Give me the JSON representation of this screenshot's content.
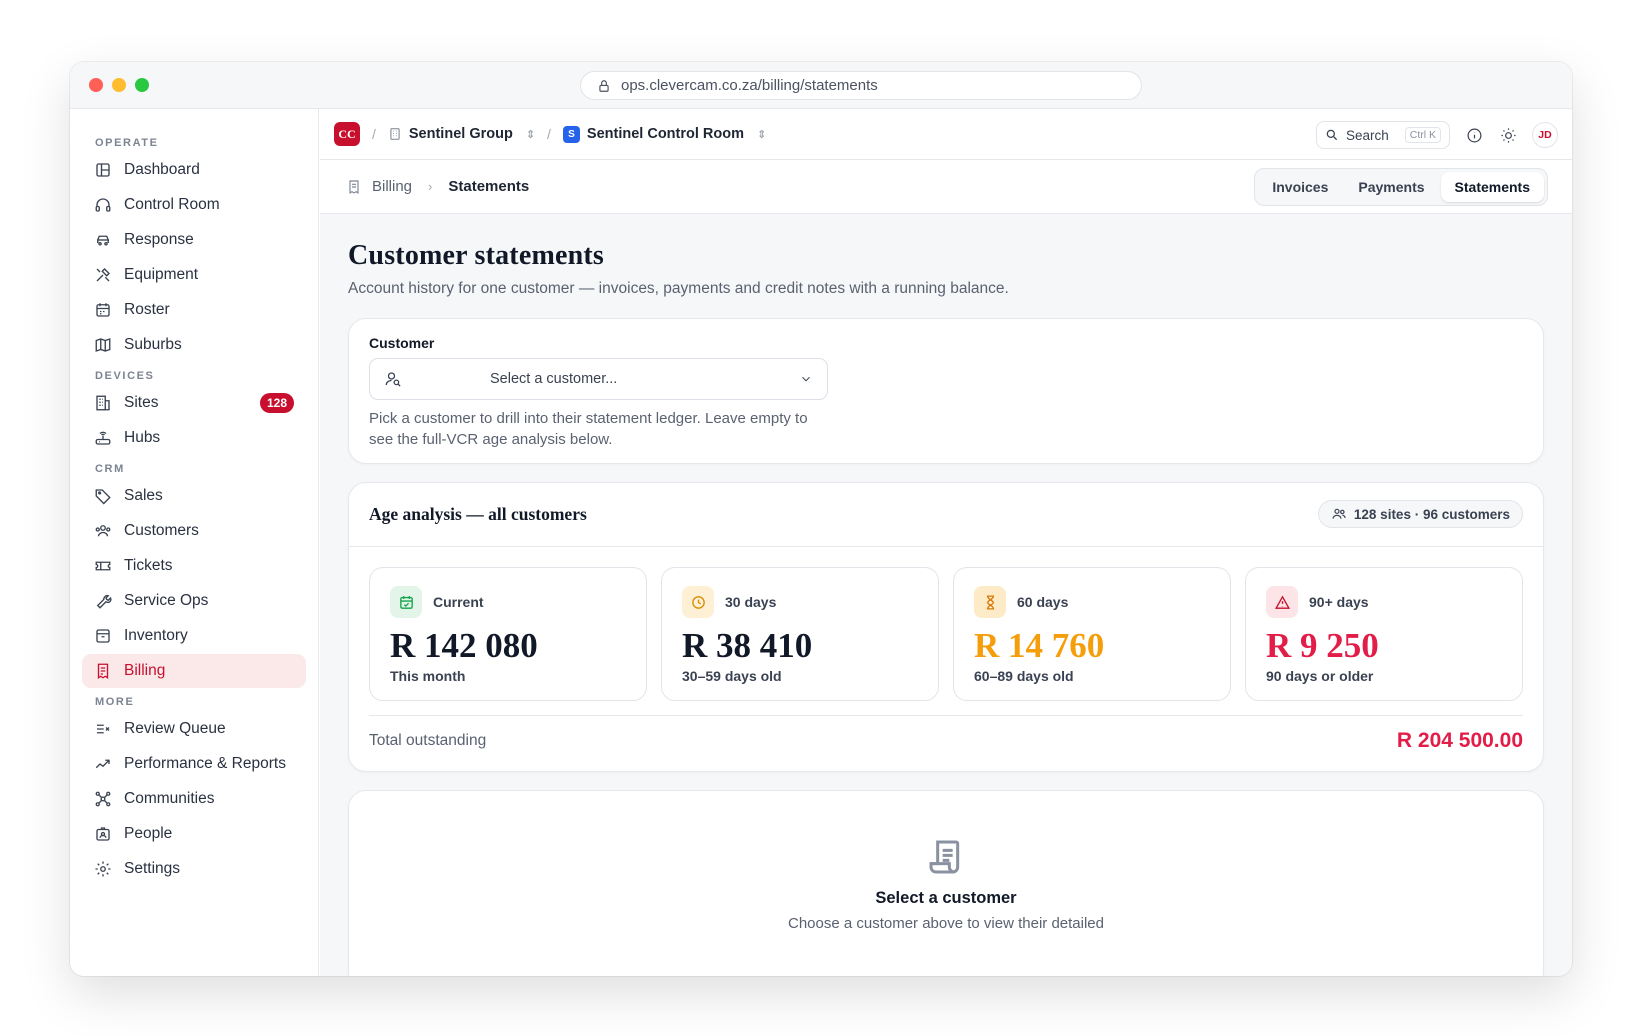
{
  "browser": {
    "url": "ops.clevercam.co.za/billing/statements"
  },
  "sidebar": {
    "sections": [
      {
        "title": "OPERATE",
        "items": [
          {
            "label": "Dashboard",
            "icon": "layout-icon"
          },
          {
            "label": "Control Room",
            "icon": "headset-icon"
          },
          {
            "label": "Response",
            "icon": "car-icon"
          },
          {
            "label": "Equipment",
            "icon": "tools-icon"
          },
          {
            "label": "Roster",
            "icon": "calendar-icon"
          },
          {
            "label": "Suburbs",
            "icon": "map-icon"
          }
        ]
      },
      {
        "title": "DEVICES",
        "items": [
          {
            "label": "Sites",
            "icon": "building-icon",
            "badge": "128"
          },
          {
            "label": "Hubs",
            "icon": "router-icon"
          }
        ]
      },
      {
        "title": "CRM",
        "items": [
          {
            "label": "Sales",
            "icon": "tag-icon"
          },
          {
            "label": "Customers",
            "icon": "users-icon"
          },
          {
            "label": "Tickets",
            "icon": "ticket-icon"
          },
          {
            "label": "Service Ops",
            "icon": "wrench-icon"
          },
          {
            "label": "Inventory",
            "icon": "archive-icon"
          },
          {
            "label": "Billing",
            "icon": "receipt-icon",
            "active": true
          }
        ]
      },
      {
        "title": "MORE",
        "items": [
          {
            "label": "Review Queue",
            "icon": "list-check-icon"
          },
          {
            "label": "Performance & Reports",
            "icon": "trend-icon"
          },
          {
            "label": "Communities",
            "icon": "network-icon"
          },
          {
            "label": "People",
            "icon": "id-badge-icon"
          },
          {
            "label": "Settings",
            "icon": "gear-icon"
          }
        ]
      }
    ]
  },
  "topbar": {
    "logo": "CC",
    "org": "Sentinel Group",
    "room_badge": "S",
    "room": "Sentinel Control Room",
    "search_label": "Search",
    "search_shortcut": "Ctrl K",
    "avatar": "JD"
  },
  "subbar": {
    "breadcrumb_parent": "Billing",
    "breadcrumb_current": "Statements",
    "tabs": [
      "Invoices",
      "Payments",
      "Statements"
    ],
    "active_tab": "Statements"
  },
  "page": {
    "title": "Customer statements",
    "lead": "Account history for one customer — invoices, payments and credit notes with a running balance."
  },
  "customer_card": {
    "label": "Customer",
    "placeholder": "Select a customer...",
    "hint": "Pick a customer to drill into their statement ledger. Leave empty to see the full-VCR age analysis below."
  },
  "age_analysis": {
    "title": "Age analysis — all customers",
    "summary": "128 sites · 96 customers",
    "buckets": [
      {
        "label": "Current",
        "amount": "R 142 080",
        "sub": "This month",
        "color": "#111827",
        "icon_bg": "#e3f5e8",
        "icon_color": "#16a34a"
      },
      {
        "label": "30 days",
        "amount": "R 38 410",
        "sub": "30–59 days old",
        "color": "#111827",
        "icon_bg": "#fdf0d5",
        "icon_color": "#d98e04"
      },
      {
        "label": "60 days",
        "amount": "R 14 760",
        "sub": "60–89 days old",
        "color": "#f59e0b",
        "icon_bg": "#fdebc8",
        "icon_color": "#d97706"
      },
      {
        "label": "90+ days",
        "amount": "R 9 250",
        "sub": "90 days or older",
        "color": "#e11d48",
        "icon_bg": "#fde4e6",
        "icon_color": "#c8102e"
      }
    ],
    "total_label": "Total outstanding",
    "total_value": "R 204 500.00"
  },
  "empty_state": {
    "title": "Select a customer",
    "description": "Choose a customer above to view their detailed"
  }
}
